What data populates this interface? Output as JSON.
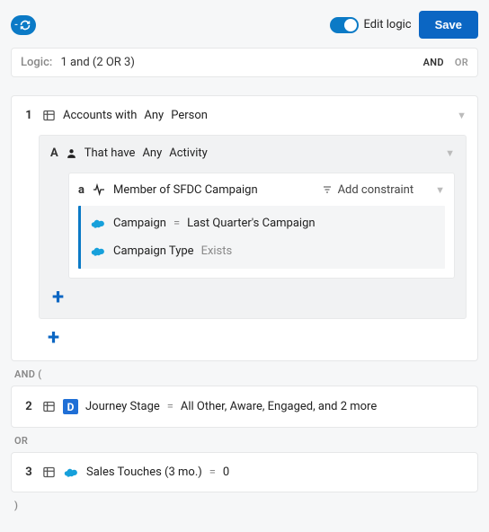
{
  "toolbar": {
    "edit_logic_label": "Edit logic",
    "save_label": "Save"
  },
  "logic": {
    "label": "Logic:",
    "expression": "1 and (2 OR 3)",
    "ops": {
      "and": "AND",
      "or": "OR"
    }
  },
  "block1": {
    "index": "1",
    "obj": "Accounts with",
    "qty": "Any",
    "rel": "Person",
    "sectionA": {
      "letter": "A",
      "prefix": "That have",
      "qty": "Any",
      "rel": "Activity",
      "sub": {
        "letter": "a",
        "label": "Member of SFDC Campaign",
        "add_constraint": "Add constraint",
        "cond1": {
          "field": "Campaign",
          "op": "=",
          "val": "Last Quarter's Campaign"
        },
        "cond2": {
          "field": "Campaign Type",
          "op": "Exists"
        }
      }
    }
  },
  "connectors": {
    "and_open": "AND (",
    "or": "OR",
    "close": ")"
  },
  "block2": {
    "index": "2",
    "field": "Journey Stage",
    "op": "=",
    "val": "All Other, Aware, Engaged, and 2 more"
  },
  "block3": {
    "index": "3",
    "field": "Sales Touches (3 mo.)",
    "op": "=",
    "val": "0"
  },
  "icons": {
    "d_letter": "D"
  }
}
